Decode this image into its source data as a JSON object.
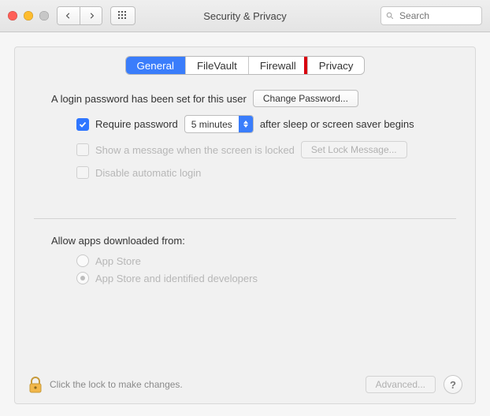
{
  "window": {
    "title": "Security & Privacy"
  },
  "toolbar": {
    "search_placeholder": "Search"
  },
  "tabs": {
    "general": "General",
    "filevault": "FileVault",
    "firewall": "Firewall",
    "privacy": "Privacy",
    "active": "general",
    "highlighted": "privacy"
  },
  "login": {
    "password_set_text": "A login password has been set for this user",
    "change_password_btn": "Change Password...",
    "require_password_label": "Require password",
    "require_password_checked": true,
    "delay_value": "5 minutes",
    "after_sleep_text": "after sleep or screen saver begins",
    "show_message_label": "Show a message when the screen is locked",
    "set_lock_message_btn": "Set Lock Message...",
    "disable_auto_login_label": "Disable automatic login"
  },
  "downloads": {
    "heading": "Allow apps downloaded from:",
    "option_appstore": "App Store",
    "option_identified": "App Store and identified developers",
    "selected": "identified"
  },
  "footer": {
    "lock_text": "Click the lock to make changes.",
    "advanced_btn": "Advanced...",
    "help": "?"
  }
}
